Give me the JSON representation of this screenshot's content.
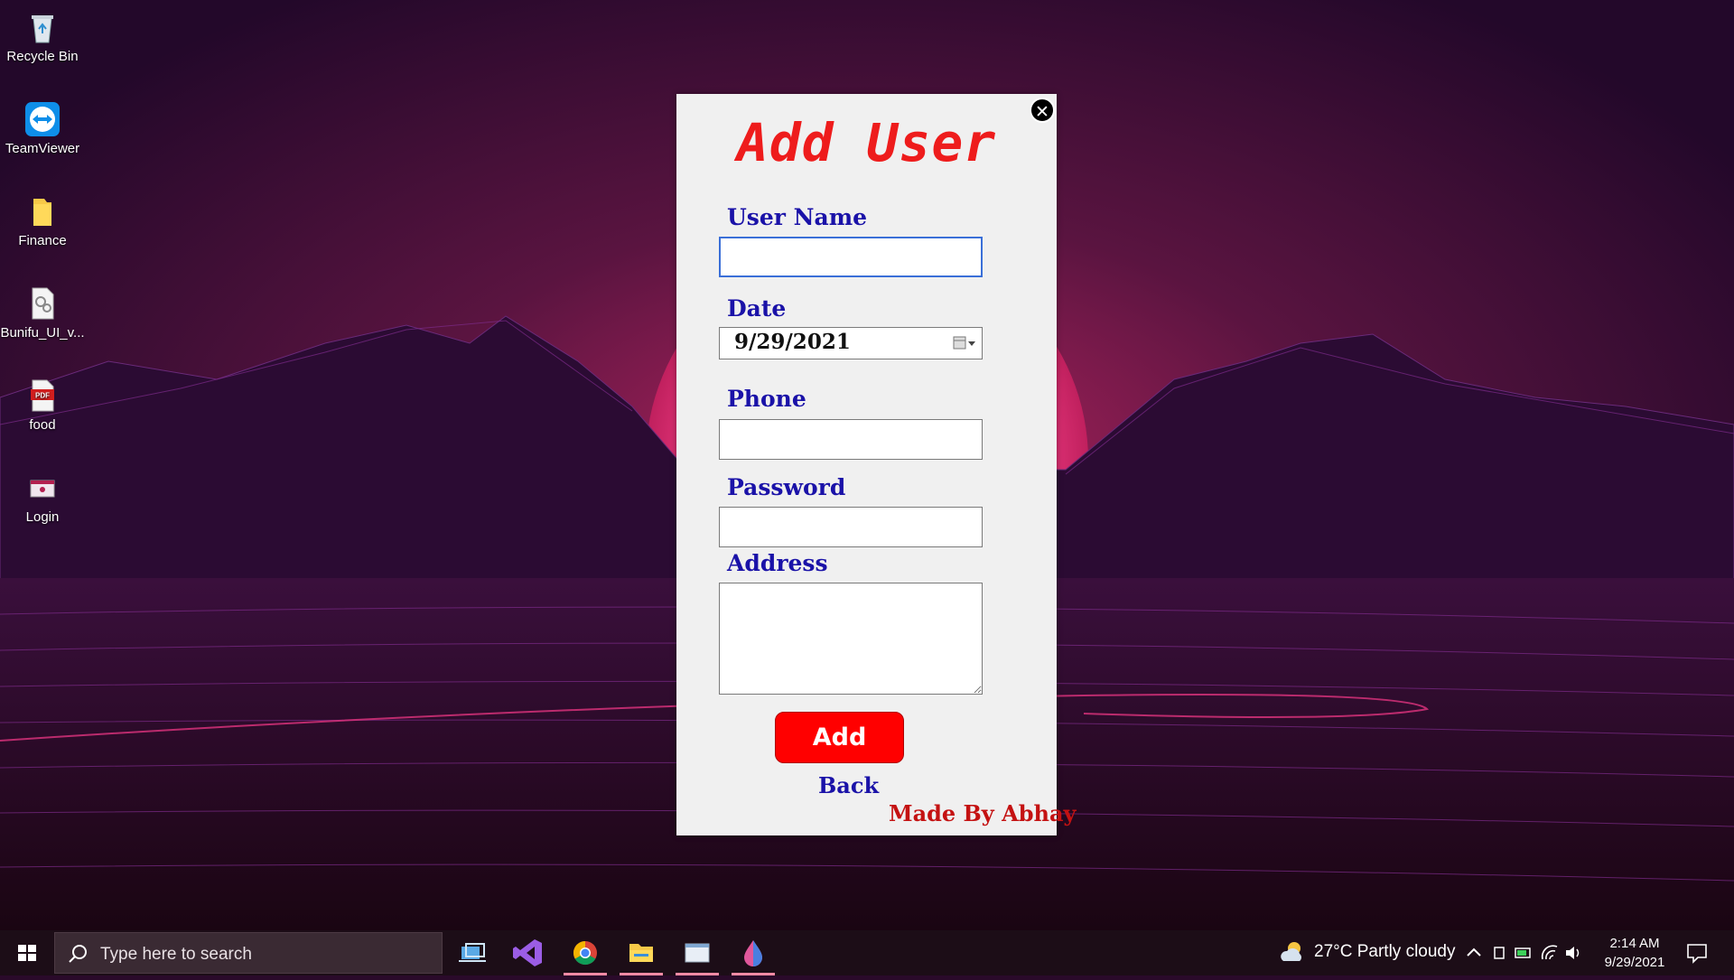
{
  "desktop": {
    "icons": [
      {
        "label": "Recycle Bin"
      },
      {
        "label": "TeamViewer"
      },
      {
        "label": "Finance"
      },
      {
        "label": "Bunifu_UI_v..."
      },
      {
        "label": "food"
      },
      {
        "label": "Login"
      }
    ]
  },
  "dialog": {
    "title": "Add User",
    "close_symbol": "✕",
    "fields": {
      "username_label": "User Name",
      "username_value": "",
      "date_label": "Date",
      "date_value": "9/29/2021",
      "phone_label": "Phone",
      "phone_value": "",
      "password_label": "Password",
      "password_value": "",
      "address_label": "Address",
      "address_value": ""
    },
    "add_button_label": "Add",
    "back_link_label": "Back",
    "credit": "Made By Abhay"
  },
  "taskbar": {
    "search_placeholder": "Type here to search",
    "apps": [
      "task-view-icon",
      "visual-studio-icon",
      "chrome-icon",
      "file-explorer-icon",
      "window-app-icon",
      "paint-drop-icon"
    ],
    "weather": "27°C  Partly cloudy",
    "time": "2:14 AM",
    "date": "9/29/2021"
  },
  "colors": {
    "title_red": "#ee1c1c",
    "label_blue": "#1a12a8",
    "button_red": "#ff0000",
    "credit_red": "#c41212",
    "dialog_bg": "#f0f0f0"
  }
}
